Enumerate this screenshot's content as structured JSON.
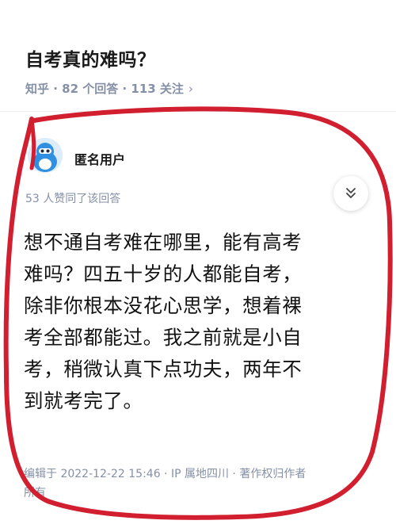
{
  "question": {
    "title": "自考真的难吗？",
    "meta": "知乎 · 82 个回答 · 113 关注",
    "meta_chevron": "›"
  },
  "answer": {
    "author": "匿名用户",
    "voters": "53 人赞同了该回答",
    "lines": [
      "想不通自考难在哪里，能有高考",
      "难吗？四五十岁的人都能自考，",
      "除非你根本没花心思学，想着裸",
      "考全部都能过。我之前就是小自",
      "考，稍微认真下点功夫，两年不",
      "到就考完了。"
    ],
    "footer_lines": [
      "编辑于 2022-12-22 15:46 · IP 属地四川 · 著作权归作者",
      "所有"
    ]
  },
  "icons": {
    "collapse": "double-chevron-down-icon",
    "avatar": "anonymous-avatar"
  },
  "colors": {
    "annotation": "#d11f30",
    "meta": "#8590a6",
    "avatar_bg": "#dcecf9",
    "avatar_figure": "#2f8fe0"
  }
}
